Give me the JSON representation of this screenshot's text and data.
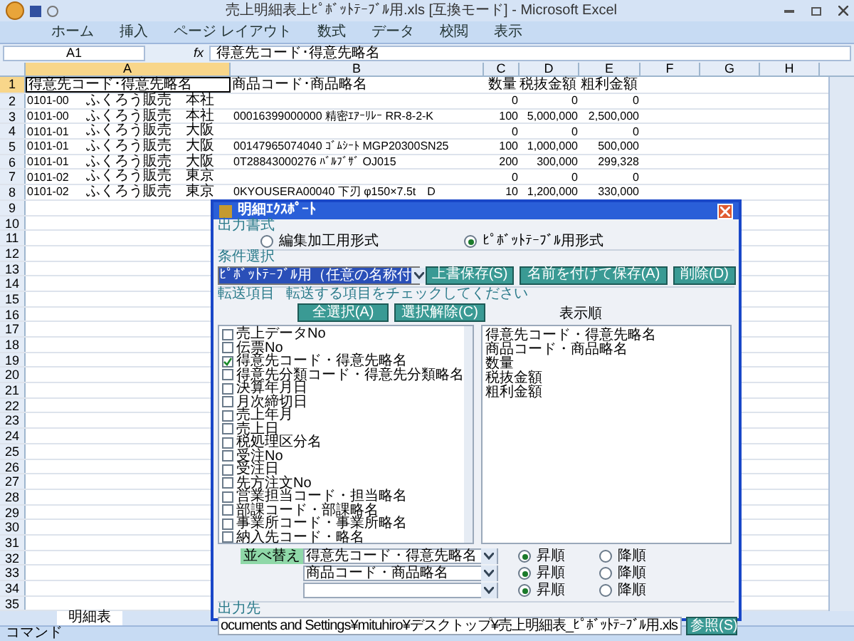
{
  "window": {
    "title": "売上明細表上ﾋﾟﾎﾞｯﾄﾃｰﾌﾞﾙ用.xls [互換モード] - Microsoft Excel"
  },
  "ribbon_tabs": [
    "ホーム",
    "挿入",
    "ページ レイアウト",
    "数式",
    "データ",
    "校閲",
    "表示"
  ],
  "formula_bar": {
    "name_box": "A1",
    "fx": "fx",
    "value": "得意先コード･得意先略名"
  },
  "columns": [
    {
      "label": "A",
      "selected": true
    },
    {
      "label": "B",
      "selected": false
    },
    {
      "label": "C",
      "selected": false
    },
    {
      "label": "D",
      "selected": false
    },
    {
      "label": "E",
      "selected": false
    },
    {
      "label": "F",
      "selected": false
    },
    {
      "label": "G",
      "selected": false
    },
    {
      "label": "H",
      "selected": false
    }
  ],
  "rows": [
    {
      "number": "1",
      "kind": "header",
      "selected": true,
      "cells": [
        "得意先コード･得意先略名",
        "商品コード･商品略名",
        "数量",
        "税抜金額",
        "粗利金額"
      ]
    },
    {
      "number": "2",
      "kind": "data",
      "selected": false,
      "code": "0101-00",
      "customer": "ふくろう販売　本社",
      "qty": "0",
      "net": "0",
      "profit": "0"
    },
    {
      "number": "3",
      "kind": "data",
      "selected": false,
      "code": "0101-00",
      "customer": "ふくろう販売　本社",
      "product": "00016399000000 精密ｴｱｰﾘﾚｰ RR-8-2-K",
      "qty": "100",
      "net": "5,000,000",
      "profit": "2,500,000"
    },
    {
      "number": "4",
      "kind": "data",
      "selected": false,
      "code": "0101-01",
      "customer": "ふくろう販売　大阪",
      "qty": "0",
      "net": "0",
      "profit": "0"
    },
    {
      "number": "5",
      "kind": "data",
      "selected": false,
      "code": "0101-01",
      "customer": "ふくろう販売　大阪",
      "product": "00147965074040 ｺﾞﾑｼｰﾄ MGP20300SN25",
      "qty": "100",
      "net": "1,000,000",
      "profit": "500,000"
    },
    {
      "number": "6",
      "kind": "data",
      "selected": false,
      "code": "0101-01",
      "customer": "ふくろう販売　大阪",
      "product": "0T28843000276 ﾊﾞﾙﾌﾞｻﾞ OJ015",
      "qty": "200",
      "net": "300,000",
      "profit": "299,328"
    },
    {
      "number": "7",
      "kind": "data",
      "selected": false,
      "code": "0101-02",
      "customer": "ふくろう販売　東京",
      "qty": "0",
      "net": "0",
      "profit": "0"
    },
    {
      "number": "8",
      "kind": "data",
      "selected": false,
      "code": "0101-02",
      "customer": "ふくろう販売　東京",
      "product": "0KYOUSERA00040 下刃 φ150×7.5t　D",
      "qty": "10",
      "net": "1,200,000",
      "profit": "330,000"
    },
    {
      "number": "9",
      "kind": "empty",
      "selected": false
    },
    {
      "number": "10",
      "kind": "empty",
      "selected": false
    },
    {
      "number": "11",
      "kind": "empty",
      "selected": false
    },
    {
      "number": "12",
      "kind": "empty",
      "selected": false
    },
    {
      "number": "13",
      "kind": "empty",
      "selected": false
    },
    {
      "number": "14",
      "kind": "empty",
      "selected": false
    },
    {
      "number": "15",
      "kind": "empty",
      "selected": false
    },
    {
      "number": "16",
      "kind": "empty",
      "selected": false
    },
    {
      "number": "17",
      "kind": "empty",
      "selected": false
    },
    {
      "number": "18",
      "kind": "empty",
      "selected": false
    },
    {
      "number": "19",
      "kind": "empty",
      "selected": false
    },
    {
      "number": "20",
      "kind": "empty",
      "selected": false
    },
    {
      "number": "21",
      "kind": "empty",
      "selected": false
    },
    {
      "number": "22",
      "kind": "empty",
      "selected": false
    },
    {
      "number": "23",
      "kind": "empty",
      "selected": false
    },
    {
      "number": "24",
      "kind": "empty",
      "selected": false
    },
    {
      "number": "25",
      "kind": "empty",
      "selected": false
    },
    {
      "number": "26",
      "kind": "empty",
      "selected": false
    },
    {
      "number": "27",
      "kind": "empty",
      "selected": false
    },
    {
      "number": "28",
      "kind": "empty",
      "selected": false
    },
    {
      "number": "29",
      "kind": "empty",
      "selected": false
    },
    {
      "number": "30",
      "kind": "empty",
      "selected": false
    },
    {
      "number": "31",
      "kind": "empty",
      "selected": false
    },
    {
      "number": "32",
      "kind": "empty",
      "selected": false
    },
    {
      "number": "33",
      "kind": "empty",
      "selected": false
    },
    {
      "number": "34",
      "kind": "empty",
      "selected": false
    },
    {
      "number": "35",
      "kind": "empty",
      "selected": false
    }
  ],
  "sheet_tabs": [
    {
      "label": "明細表",
      "selected": true
    }
  ],
  "status_bar": "コマンド",
  "dialog": {
    "title": "明細ｴｸｽﾎﾟｰﾄ",
    "output_format": {
      "label": "出力書式",
      "options": [
        {
          "label": "編集加工用形式",
          "selected": false
        },
        {
          "label": "ﾋﾟﾎﾞｯﾄﾃｰﾌﾞﾙ用形式",
          "selected": true
        }
      ]
    },
    "condition": {
      "label": "条件選択",
      "value": "ﾋﾟﾎﾞｯﾄﾃｰﾌﾞﾙ用（任意の名称付",
      "buttons": [
        "上書保存(S)",
        "名前を付けて保存(A)",
        "削除(D)"
      ]
    },
    "transfer": {
      "label": "転送項目",
      "hint": "転送する項目をチェックしてください",
      "buttons": [
        "全選択(A)",
        "選択解除(C)"
      ],
      "items": [
        {
          "label": "売上データNo",
          "checked": false
        },
        {
          "label": "伝票No",
          "checked": false
        },
        {
          "label": "得意先コード・得意先略名",
          "checked": true
        },
        {
          "label": "得意先分類コード・得意先分類略名",
          "checked": false
        },
        {
          "label": "決算年月日",
          "checked": false
        },
        {
          "label": "月次締切日",
          "checked": false
        },
        {
          "label": "売上年月",
          "checked": false
        },
        {
          "label": "売上日",
          "checked": false
        },
        {
          "label": "税処理区分名",
          "checked": false
        },
        {
          "label": "受注No",
          "checked": false
        },
        {
          "label": "受注日",
          "checked": false
        },
        {
          "label": "先方注文No",
          "checked": false
        },
        {
          "label": "営業担当コード・担当略名",
          "checked": false
        },
        {
          "label": "部課コード・部課略名",
          "checked": false
        },
        {
          "label": "事業所コード・事業所略名",
          "checked": false
        },
        {
          "label": "納入先コード・略名",
          "checked": false
        }
      ],
      "order_label": "表示順",
      "order": [
        "得意先コード・得意先略名",
        "商品コード・商品略名",
        "数量",
        "税抜金額",
        "粗利金額"
      ]
    },
    "sort": {
      "label": "並べ替え",
      "rows": [
        {
          "value": "得意先コード・得意先略名",
          "options": [
            {
              "label": "昇順",
              "selected": true
            },
            {
              "label": "降順",
              "selected": false
            }
          ]
        },
        {
          "value": "商品コード・商品略名",
          "options": [
            {
              "label": "昇順",
              "selected": true
            },
            {
              "label": "降順",
              "selected": false
            }
          ]
        },
        {
          "options": [
            {
              "label": "昇順",
              "selected": true
            },
            {
              "label": "降順",
              "selected": false
            }
          ]
        }
      ]
    },
    "output": {
      "label": "出力先",
      "path": "ocuments and Settings¥mituhiro¥デスクトップ¥売上明細表_ﾋﾟﾎﾞｯﾄﾃｰﾌﾞﾙ用.xls",
      "button": "参照(S)"
    }
  }
}
